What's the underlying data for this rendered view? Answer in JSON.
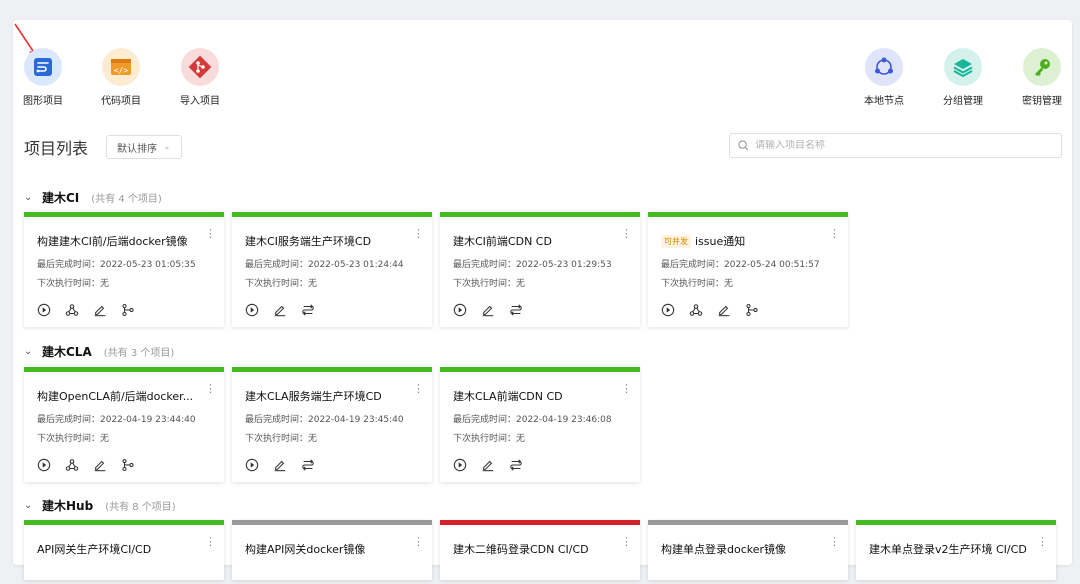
{
  "toolbar": {
    "left": [
      {
        "label": "图形项目",
        "icon": "flow-project-icon",
        "color": "#2a6ad8",
        "bg": "#dbe7fb"
      },
      {
        "label": "代码项目",
        "icon": "code-project-icon",
        "color": "#f29a29",
        "bg": "#fdebd2"
      },
      {
        "label": "导入项目",
        "icon": "git-import-icon",
        "color": "#d43a3a",
        "bg": "#f8dcdc"
      }
    ],
    "right": [
      {
        "label": "本地节点",
        "icon": "local-node-icon",
        "color": "#3d5ad8",
        "bg": "#dfe4f9"
      },
      {
        "label": "分组管理",
        "icon": "group-layers-icon",
        "color": "#17b59a",
        "bg": "#d5f1ec"
      },
      {
        "label": "密钥管理",
        "icon": "key-icon",
        "color": "#4cae20",
        "bg": "#ddf1d2"
      }
    ]
  },
  "page": {
    "title": "项目列表",
    "sort_label": "默认排序",
    "search_placeholder": "请输入项目名称"
  },
  "groups": [
    {
      "name": "建木CI",
      "count_text": "(共有 4 个项目)",
      "cards": [
        {
          "name": "构建建木CI前/后端docker镜像",
          "last_label": "最后完成时间：",
          "last": "2022-05-23 01:05:35",
          "next_label": "下次执行时间：",
          "next": "无",
          "status": "green",
          "actions": [
            "play",
            "webhook",
            "edit",
            "branch"
          ]
        },
        {
          "name": "建木CI服务端生产环境CD",
          "last_label": "最后完成时间：",
          "last": "2022-05-23 01:24:44",
          "next_label": "下次执行时间：",
          "next": "无",
          "status": "green",
          "actions": [
            "play",
            "edit",
            "flow"
          ]
        },
        {
          "name": "建木CI前端CDN CD",
          "last_label": "最后完成时间：",
          "last": "2022-05-23 01:29:53",
          "next_label": "下次执行时间：",
          "next": "无",
          "status": "green",
          "actions": [
            "play",
            "edit",
            "flow"
          ]
        },
        {
          "badge": "可并发",
          "name": "issue通知",
          "last_label": "最后完成时间：",
          "last": "2022-05-24 00:51:57",
          "next_label": "下次执行时间：",
          "next": "无",
          "status": "green",
          "actions": [
            "play",
            "webhook",
            "edit",
            "branch"
          ]
        }
      ]
    },
    {
      "name": "建木CLA",
      "count_text": "(共有 3 个项目)",
      "cards": [
        {
          "name": "构建OpenCLA前/后端docker...",
          "last_label": "最后完成时间：",
          "last": "2022-04-19 23:44:40",
          "next_label": "下次执行时间：",
          "next": "无",
          "status": "green",
          "actions": [
            "play",
            "webhook",
            "edit",
            "branch"
          ]
        },
        {
          "name": "建木CLA服务端生产环境CD",
          "last_label": "最后完成时间：",
          "last": "2022-04-19 23:45:40",
          "next_label": "下次执行时间：",
          "next": "无",
          "status": "green",
          "actions": [
            "play",
            "edit",
            "flow"
          ]
        },
        {
          "name": "建木CLA前端CDN CD",
          "last_label": "最后完成时间：",
          "last": "2022-04-19 23:46:08",
          "next_label": "下次执行时间：",
          "next": "无",
          "status": "green",
          "actions": [
            "play",
            "edit",
            "flow"
          ]
        }
      ]
    },
    {
      "name": "建木Hub",
      "count_text": "(共有 8 个项目)",
      "cards": [
        {
          "name": "API网关生产环境CI/CD",
          "status": "green"
        },
        {
          "name": "构建API网关docker镜像",
          "status": "gray"
        },
        {
          "name": "建木二维码登录CDN CI/CD",
          "status": "red"
        },
        {
          "name": "构建单点登录docker镜像",
          "status": "gray"
        },
        {
          "name": "建木单点登录v2生产环境 CI/CD",
          "status": "green"
        }
      ]
    }
  ],
  "colors": {
    "ok": "#44bb22",
    "failed": "#d4242a",
    "idle": "#999999",
    "accent": "#2a6ad8"
  }
}
